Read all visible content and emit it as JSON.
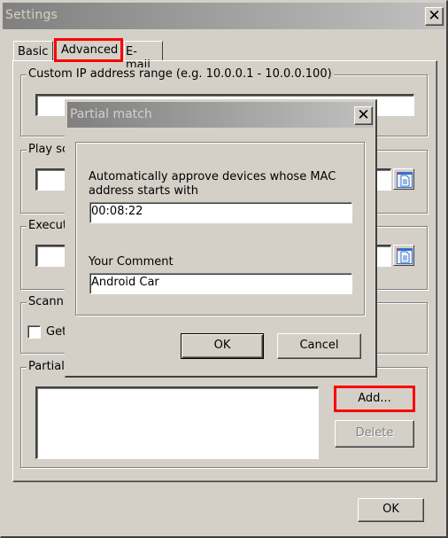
{
  "window": {
    "title": "Settings",
    "close_label": "✕"
  },
  "tabs": [
    {
      "label": "Basic",
      "active": false
    },
    {
      "label": "Advanced",
      "active": true,
      "highlighted": true
    },
    {
      "label": "E-mail",
      "active": false
    }
  ],
  "groups": {
    "ip_range": {
      "legend": "Custom IP address range (e.g. 10.0.0.1 - 10.0.0.100)",
      "value": ""
    },
    "play_sound": {
      "legend": "Play sc",
      "value": "",
      "browse_icon": "document-icon"
    },
    "execute": {
      "legend": "Execut",
      "value": "",
      "browse_icon": "document-icon"
    },
    "scanning": {
      "legend": "Scanni",
      "checkbox_label": "Get",
      "checked": false
    },
    "partial": {
      "legend": "Partial",
      "list_items": [],
      "add_label": "Add...",
      "delete_label": "Delete",
      "add_highlighted": true,
      "delete_enabled": false
    }
  },
  "footer": {
    "ok_label": "OK"
  },
  "dialog": {
    "title": "Partial match",
    "close_label": "✕",
    "mac_label": "Automatically approve devices whose MAC address starts with",
    "mac_value": "00:08:22",
    "comment_label": "Your Comment",
    "comment_value": "Android Car",
    "ok_label": "OK",
    "cancel_label": "Cancel"
  },
  "colors": {
    "highlight": "#ff0000",
    "face": "#d4d0c8",
    "title_gradient_start": "#808080",
    "title_gradient_end": "#c0c0c0"
  }
}
